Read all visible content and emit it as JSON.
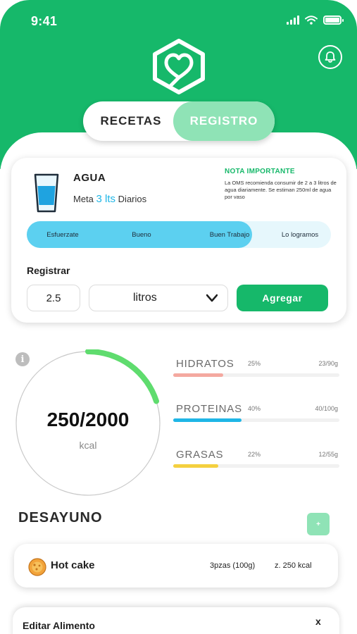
{
  "status_bar": {
    "time": "9:41"
  },
  "header": {
    "logo_icon": "heart-house-icon",
    "bell_icon": "bell-icon",
    "brand_color": "#16b86a"
  },
  "tabs": {
    "left_label": "RECETAS",
    "right_label": "REGISTRO",
    "active": "REGISTRO"
  },
  "water": {
    "title": "AGUA",
    "goal_prefix": "Meta",
    "goal_number": "3 lts",
    "goal_suffix": "Diarios",
    "note_title": "NOTA IMPORTANTE",
    "note_text": "La OMS recomienda consumir de 2 a 3 litros de agua diariamente. Se estiman 250ml de agua por vaso",
    "progress_fraction": 0.74,
    "stages": [
      "Esfuerzate",
      "Bueno",
      "Buen Trabajo",
      "Lo logramos"
    ],
    "register_label": "Registrar",
    "quantity_value": "2.5",
    "unit_value": "litros",
    "add_label": "Agregar"
  },
  "calories": {
    "value": "250/2000",
    "unit": "kcal",
    "ring_fraction": 0.2,
    "ring_color": "#5fdc6e"
  },
  "macros": [
    {
      "name": "HIDRATOS",
      "percent": "25%",
      "ratio": "23/90g",
      "fill_fraction": 0.3,
      "color": "#f4a9a0"
    },
    {
      "name": "PROTEINAS",
      "percent": "40%",
      "ratio": "40/100g",
      "fill_fraction": 0.41,
      "color": "#1fb6e6"
    },
    {
      "name": "GRASAS",
      "percent": "22%",
      "ratio": "12/55g",
      "fill_fraction": 0.27,
      "color": "#f4d03f"
    }
  ],
  "meal": {
    "title": "DESAYUNO",
    "add_label": "+",
    "items": [
      {
        "name": "Hot cake",
        "portion": "3pzas (100g)",
        "kcal": "z. 250 kcal",
        "icon": "pancake-icon"
      }
    ]
  },
  "edit_sheet": {
    "title": "Editar Alimento",
    "close_label": "x"
  }
}
